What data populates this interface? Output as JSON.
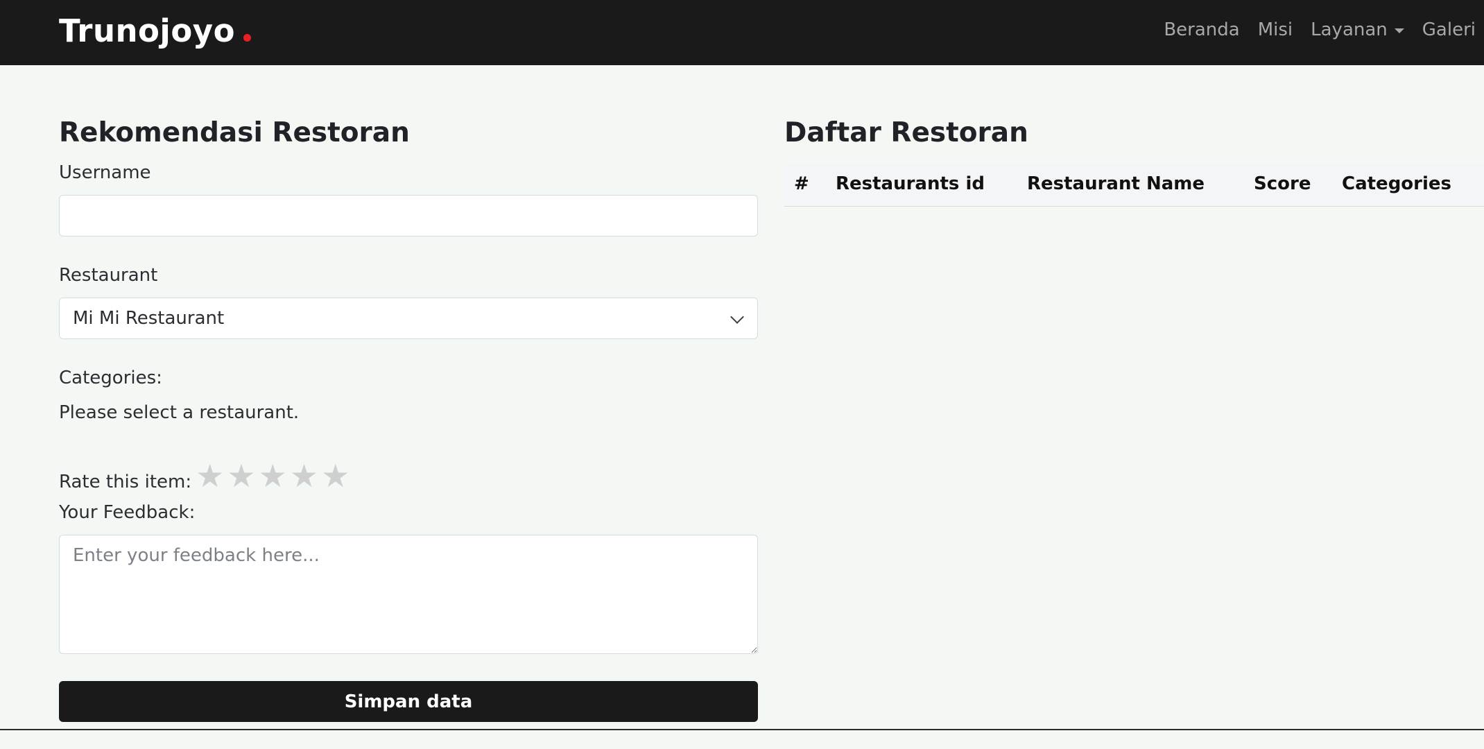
{
  "navbar": {
    "brand": "Trunojoyo",
    "links": [
      "Beranda",
      "Misi",
      "Layanan",
      "Galeri"
    ]
  },
  "form": {
    "title": "Rekomendasi Restoran",
    "username_label": "Username",
    "username_value": "",
    "restaurant_label": "Restaurant",
    "restaurant_selected": "Mi Mi Restaurant",
    "categories_label": "Categories:",
    "categories_message": "Please select a restaurant.",
    "rating_label": "Rate this item:",
    "rating_star": "★",
    "rating_value": 0,
    "rating_max": 5,
    "feedback_label": "Your Feedback:",
    "feedback_placeholder": "Enter your feedback here...",
    "submit_label": "Simpan data"
  },
  "table": {
    "title": "Daftar Restoran",
    "columns": [
      "#",
      "Restaurants id",
      "Restaurant Name",
      "Score",
      "Categories"
    ],
    "rows": []
  },
  "colors": {
    "navbar_bg": "#1b1a1a",
    "brand_dot": "#ea1f24",
    "page_bg": "#f4f8f5",
    "button_bg": "#1b1a1a",
    "star_inactive": "#cfcfcf"
  }
}
